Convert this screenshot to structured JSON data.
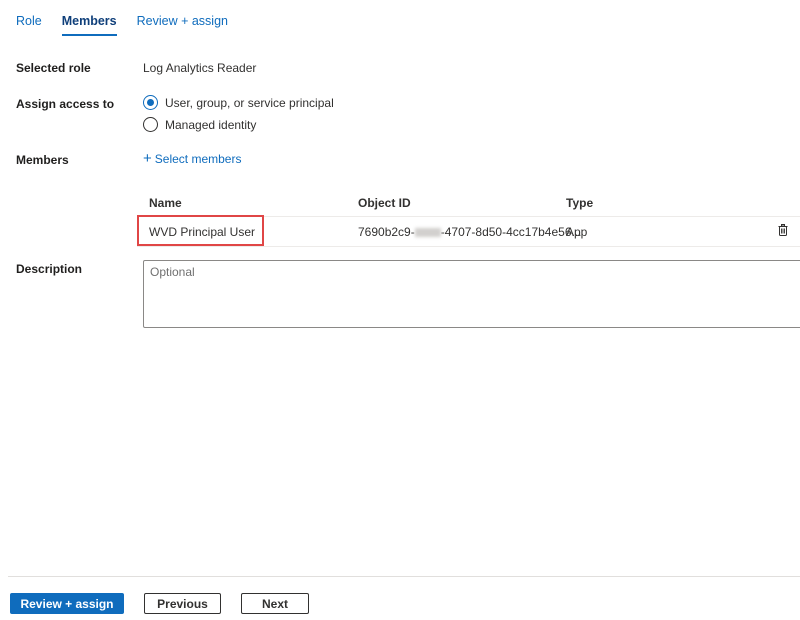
{
  "tabs": [
    {
      "label": "Role",
      "active": false
    },
    {
      "label": "Members",
      "active": true
    },
    {
      "label": "Review + assign",
      "active": false
    }
  ],
  "form": {
    "selected_role_label": "Selected role",
    "selected_role_value": "Log Analytics Reader",
    "assign_access_label": "Assign access to",
    "assign_options": [
      {
        "label": "User, group, or service principal",
        "checked": true
      },
      {
        "label": "Managed identity",
        "checked": false
      }
    ],
    "members_label": "Members",
    "select_members_link": "Select members",
    "description_label": "Description",
    "description_placeholder": "Optional",
    "description_value": ""
  },
  "members_table": {
    "columns": [
      "Name",
      "Object ID",
      "Type"
    ],
    "rows": [
      {
        "name": "WVD Principal User",
        "object_id_prefix": "7690b2c9-",
        "object_id_suffix": "-4707-8d50-4cc17b4e56...",
        "type": "App",
        "highlighted": true
      }
    ]
  },
  "highlight_color": "#e04646",
  "accent_color": "#0f6cbd",
  "footer": {
    "primary_button": "Review + assign",
    "previous_button": "Previous",
    "next_button": "Next"
  }
}
